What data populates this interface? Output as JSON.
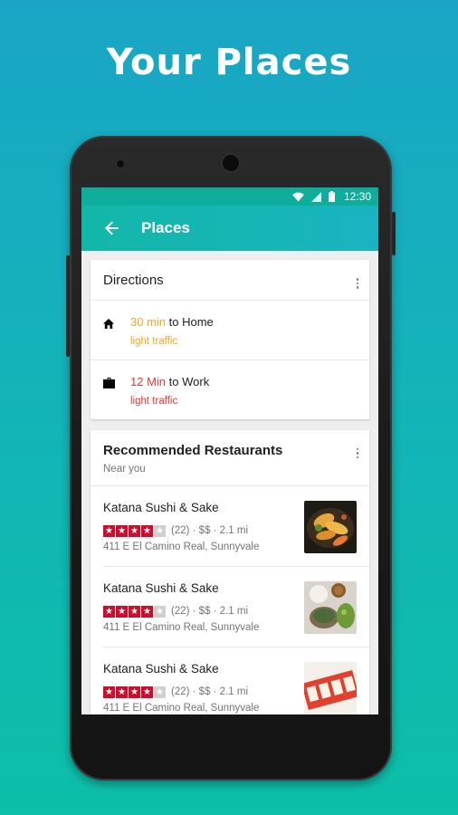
{
  "headline": "Your Places",
  "status": {
    "time": "12:30",
    "icons": [
      "wifi-icon",
      "signal-icon",
      "battery-icon"
    ]
  },
  "appbar": {
    "title": "Places",
    "back_icon": "arrow-left-icon"
  },
  "directions": {
    "title": "Directions",
    "items": [
      {
        "icon": "home-icon",
        "duration": "30 min",
        "destination": "to Home",
        "traffic": "light traffic",
        "color": "#f5a623"
      },
      {
        "icon": "briefcase-icon",
        "duration": "12 Min",
        "destination": "to Work",
        "traffic": "light traffic",
        "color": "#e53935"
      }
    ]
  },
  "restaurants": {
    "title": "Recommended Restaurants",
    "subtitle": "Near you",
    "items": [
      {
        "name": "Katana Sushi & Sake",
        "stars": 4,
        "meta": "(22) · $$ · 2.1 mi",
        "address": "411 E El Camino Real, Sunnyvale",
        "thumb": "tempura-photo"
      },
      {
        "name": "Katana Sushi & Sake",
        "stars": 4,
        "meta": "(22) · $$ · 2.1 mi",
        "address": "411 E El Camino Real, Sunnyvale",
        "thumb": "bento-photo"
      },
      {
        "name": "Katana Sushi & Sake",
        "stars": 4,
        "meta": "(22) · $$ · 2.1 mi",
        "address": "411 E El Camino Real, Sunnyvale",
        "thumb": "sushi-roll-photo"
      }
    ]
  },
  "colors": {
    "accent": "#13b7a8",
    "star": "#c8102e",
    "amber": "#f5a623",
    "red": "#e53935"
  }
}
